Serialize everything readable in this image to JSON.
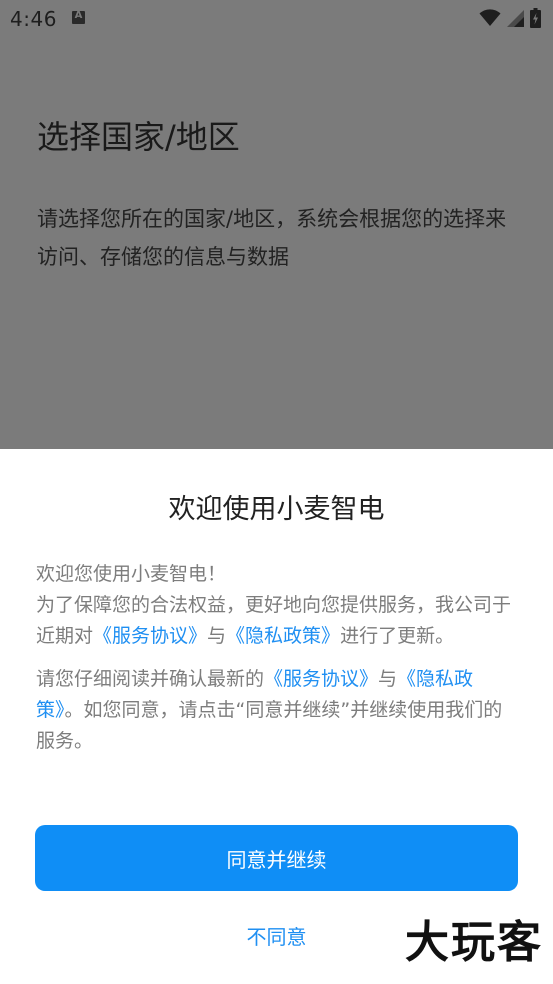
{
  "status_bar": {
    "time": "4:46",
    "icons": [
      "notification-a-icon",
      "wifi-icon",
      "signal-icon",
      "battery-charging-icon"
    ]
  },
  "background": {
    "title": "选择国家/地区",
    "description": "请选择您所在的国家/地区，系统会根据您的选择来访问、存储您的信息与数据"
  },
  "dialog": {
    "title": "欢迎使用小麦智电",
    "para1": {
      "line1": "欢迎您使用小麦智电！",
      "text_a": "为了保障您的合法权益，更好地向您提供服务，我公司于近期对",
      "link1": "《服务协议》",
      "text_b": "与",
      "link2": "《隐私政策》",
      "text_c": "进行了更新。"
    },
    "para2": {
      "text_a": "请您仔细阅读并确认最新的",
      "link1": "《服务协议》",
      "text_b": "与",
      "link2": "《隐私政策》",
      "text_c": "。如您同意，请点击“同意并继续”并继续使用我们的服务。"
    },
    "agree_label": "同意并继续",
    "disagree_label": "不同意"
  },
  "watermark": "大玩客",
  "colors": {
    "accent": "#0f8ef6",
    "link": "#1f8ff2",
    "scrim_bg": "#7b7b7b"
  }
}
